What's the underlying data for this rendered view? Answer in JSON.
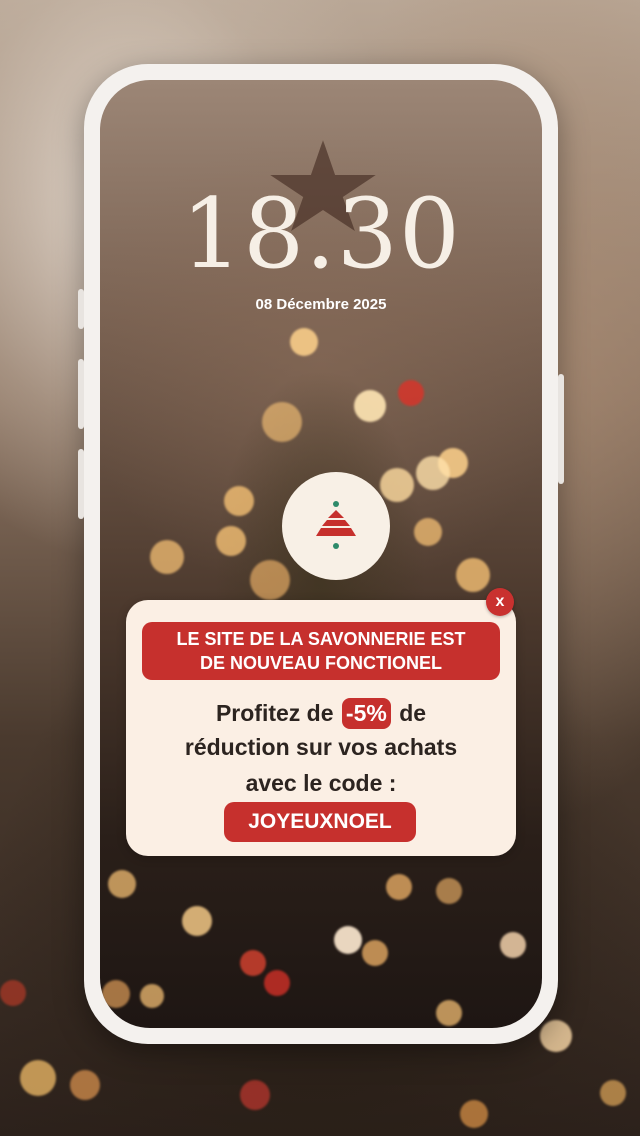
{
  "lockscreen": {
    "time": "18.30",
    "date": "08 Décembre 2025"
  },
  "logo": {
    "icon": "savonnerie-logo-icon"
  },
  "notification": {
    "close_label": "x",
    "title_line1": "LE SITE DE LA SAVONNERIE EST",
    "title_line2": "DE NOUVEAU FONCTIONEL",
    "line1_pre": "Profitez de",
    "discount": "-5%",
    "line1_post": "de",
    "line2": "réduction sur vos achats",
    "line3": "avec le code :",
    "code": "JOYEUXNOEL"
  },
  "colors": {
    "accent": "#c6302d",
    "card": "#fbefe4"
  }
}
